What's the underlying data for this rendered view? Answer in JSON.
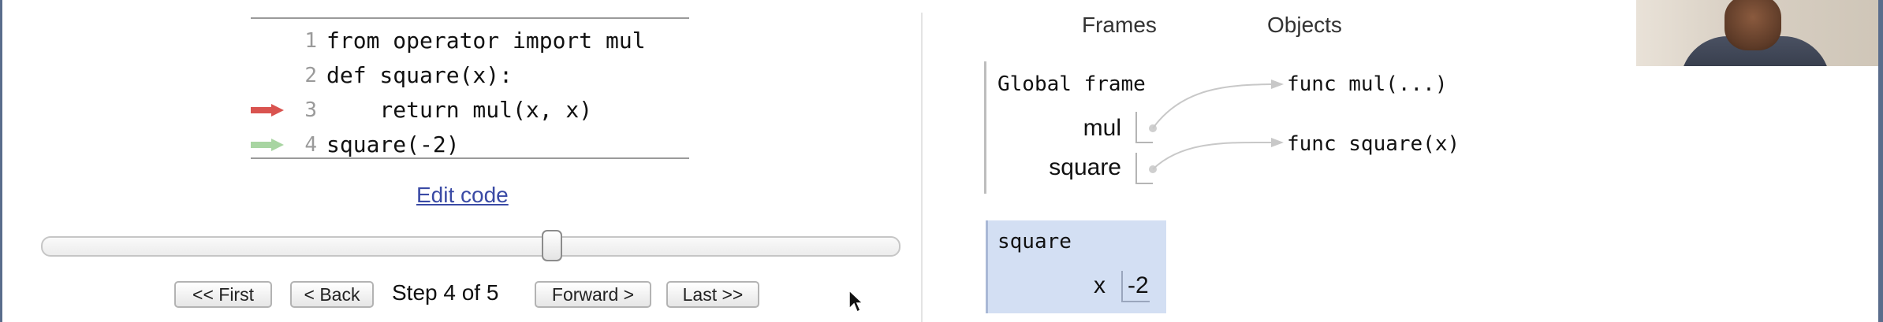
{
  "code": {
    "lines": [
      {
        "number": "1",
        "text": "from operator import mul"
      },
      {
        "number": "2",
        "text": "def square(x):"
      },
      {
        "number": "3",
        "text": "    return mul(x, x)"
      },
      {
        "number": "4",
        "text": "square(-2)"
      }
    ],
    "current_line_arrow_color": "#d9534f",
    "next_line_arrow_color": "#a8d5a2",
    "edit_link": "Edit code"
  },
  "navigation": {
    "first": "<< First",
    "back": "< Back",
    "step_text": "Step 4 of 5",
    "forward": "Forward >",
    "last": "Last >>",
    "step_progress": 0.6
  },
  "visualization": {
    "frames_header": "Frames",
    "objects_header": "Objects",
    "global_frame": {
      "title": "Global frame",
      "variables": [
        {
          "name": "mul"
        },
        {
          "name": "square"
        }
      ]
    },
    "objects": [
      "func mul(...)",
      "func square(x)"
    ],
    "local_frame": {
      "title": "square",
      "variables": [
        {
          "name": "x",
          "value": "-2"
        }
      ],
      "background_color": "#d3dff3"
    }
  }
}
